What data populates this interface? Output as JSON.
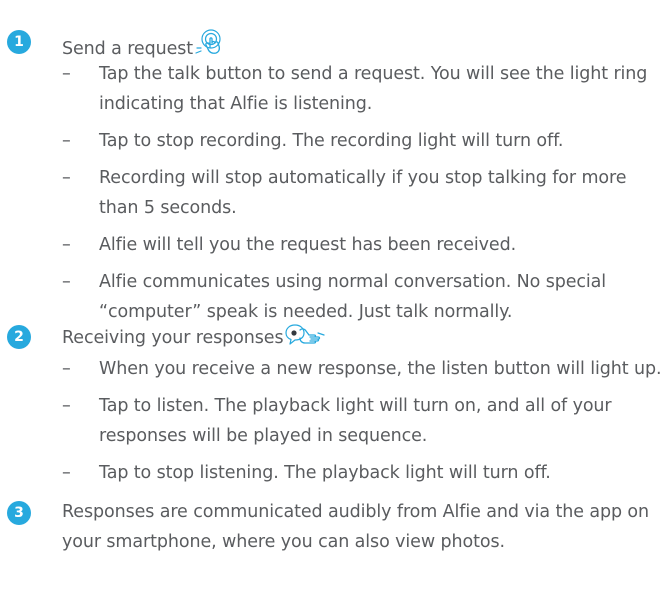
{
  "steps": [
    {
      "number": "1",
      "heading": "Send a request",
      "icon": "tap-hand-icon",
      "bullets": [
        "Tap the talk button to send a request. You will see the light ring indicating that Alfie is listening.",
        "Tap to stop recording. The recording light will turn off.",
        "Recording will stop automatically if you stop talking for more than 5 seconds.",
        "Alfie will tell you the request has been received.",
        "Alfie communicates using normal conversation. No special “computer” speak is needed. Just talk normally."
      ]
    },
    {
      "number": "2",
      "heading": "Receiving your responses",
      "icon": "speech-bubble-hand-icon",
      "bullets": [
        "When you receive a new response, the listen button will light up.",
        "Tap to listen. The playback light will turn on, and all of your responses will be played in sequence.",
        "Tap to stop listening. The playback light will turn off."
      ]
    },
    {
      "number": "3",
      "text": "Responses are communicated audibly from Alfie and via the app on your smartphone, where you can also view photos."
    }
  ],
  "dash_glyph": "–",
  "colors": {
    "badge": "#27a9de",
    "text": "#5a5c5f",
    "icon_stroke": "#27a9de"
  }
}
